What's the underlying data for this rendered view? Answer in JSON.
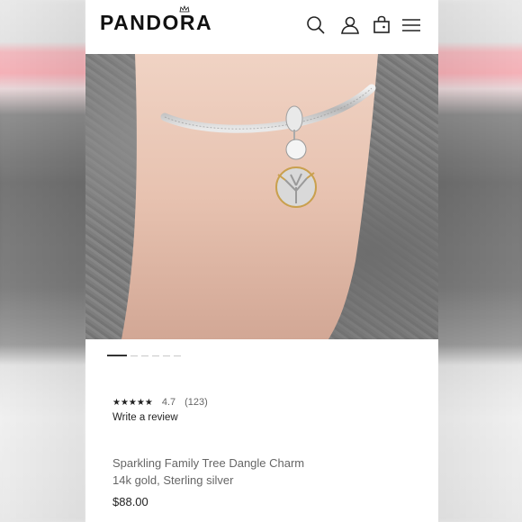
{
  "header": {
    "logo": "PANDORA",
    "icons": [
      "search-icon",
      "user-icon",
      "bag-icon",
      "menu-icon"
    ]
  },
  "carousel": {
    "slides": 6,
    "active": 1
  },
  "review": {
    "stars": "★★★★★",
    "rating": "4.7",
    "count": "(123)",
    "write_review": "Write a review"
  },
  "product": {
    "title": "Sparkling Family Tree Dangle Charm",
    "materials": "14k gold, Sterling silver",
    "price": "$88.00"
  },
  "colors": {
    "text_dark": "#222222",
    "text_muted": "#666666",
    "background": "#ffffff"
  }
}
